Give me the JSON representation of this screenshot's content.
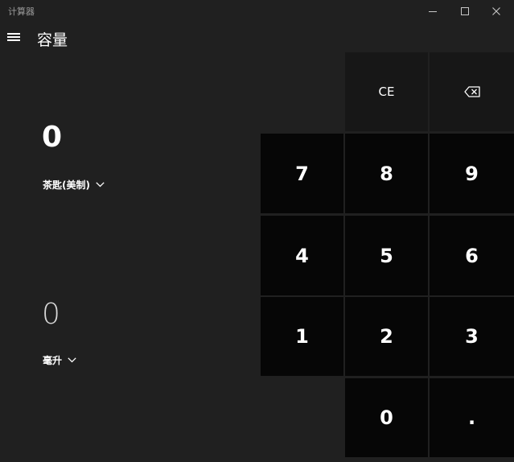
{
  "window": {
    "title": "计算器"
  },
  "header": {
    "mode_title": "容量"
  },
  "converter": {
    "from_value": "0",
    "from_unit": "茶匙(美制)",
    "to_value": "0",
    "to_unit": "毫升"
  },
  "keypad": {
    "ce": "CE",
    "seven": "7",
    "eight": "8",
    "nine": "9",
    "four": "4",
    "five": "5",
    "six": "6",
    "one": "1",
    "two": "2",
    "three": "3",
    "zero": "0",
    "decimal": "."
  },
  "icons": {
    "menu": "hamburger-icon",
    "backspace": "backspace-icon",
    "minimize": "minimize-icon",
    "maximize": "maximize-icon",
    "close": "close-icon",
    "chevron": "chevron-down-icon"
  },
  "colors": {
    "background": "#202020",
    "number_key": "#060606",
    "function_key": "#171717",
    "text": "#ffffff"
  }
}
